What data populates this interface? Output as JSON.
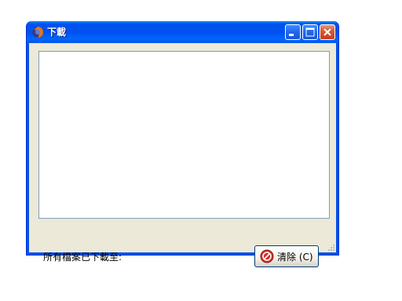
{
  "window": {
    "title": "下載",
    "icon": "firefox-icon",
    "controls": [
      "minimize-icon",
      "maximize-icon",
      "close-icon"
    ]
  },
  "status": {
    "label": "所有檔案已下載至:"
  },
  "clear_button": {
    "label": "清除 (C)",
    "icon": "clear-icon"
  },
  "colors": {
    "titlebar": "#0054e3",
    "client_bg": "#ece9d8",
    "close_button": "#d85a38"
  }
}
